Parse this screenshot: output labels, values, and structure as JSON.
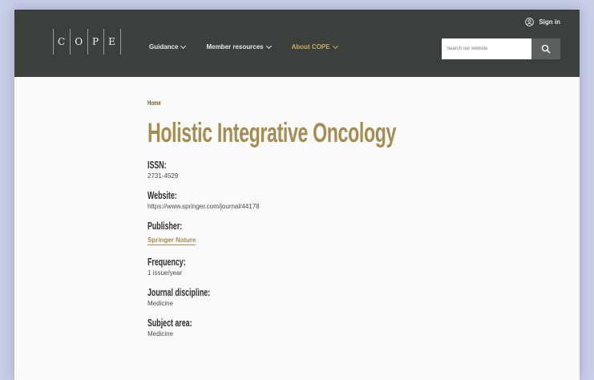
{
  "header": {
    "logo_letters": [
      "C",
      "O",
      "P",
      "E"
    ],
    "nav": [
      {
        "label": "Guidance",
        "active": false
      },
      {
        "label": "Member resources",
        "active": false
      },
      {
        "label": "About COPE",
        "active": true
      }
    ],
    "sign_in_label": "Sign in",
    "search_placeholder": "Search our website"
  },
  "breadcrumb": "Home",
  "page_title": "Holistic Integrative Oncology",
  "fields": {
    "issn": {
      "label": "ISSN:",
      "value": "2731-4529"
    },
    "website": {
      "label": "Website:",
      "value": "https://www.springer.com/journal/44178"
    },
    "publisher": {
      "label": "Publisher:",
      "value": "Springer Nature"
    },
    "frequency": {
      "label": "Frequency:",
      "value": "1 issue/year"
    },
    "discipline": {
      "label": "Journal discipline:",
      "value": "Medicine"
    },
    "subject": {
      "label": "Subject area:",
      "value": "Medicine"
    }
  },
  "colors": {
    "header_bg": "#3b403d",
    "accent_gold": "#a58c52",
    "page_bg": "#fafafa",
    "search_button": "#5c6160"
  },
  "icons": [
    "user-circle-icon",
    "search-icon",
    "chevron-down-icon"
  ]
}
